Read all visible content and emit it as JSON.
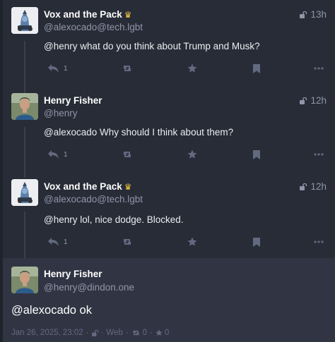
{
  "colors": {
    "background": "#282c37",
    "focused_background": "#313543",
    "muted_text": "#8e96a8",
    "icon": "#626a80",
    "crown": "#f2c744"
  },
  "statuses": [
    {
      "display_name": "Vox and the Pack",
      "badge_icon": "crown-icon",
      "handle": "@alexocado@tech.lgbt",
      "time": "13h",
      "visibility_icon": "unlock-icon",
      "text": "@henry what do you think about Trump and Musk?",
      "reply_count": "1"
    },
    {
      "display_name": "Henry Fisher",
      "handle": "@henry",
      "time": "12h",
      "visibility_icon": "unlock-icon",
      "text": "@alexocado Why should I think about them?",
      "reply_count": "1"
    },
    {
      "display_name": "Vox and the Pack",
      "badge_icon": "crown-icon",
      "handle": "@alexocado@tech.lgbt",
      "time": "12h",
      "visibility_icon": "unlock-icon",
      "text": "@henry lol, nice dodge. Blocked.",
      "reply_count": "1"
    }
  ],
  "detailed_status": {
    "display_name": "Henry Fisher",
    "handle": "@henry@dindon.one",
    "text": "@alexocado ok",
    "date": "Jan 26, 2025, 23:02",
    "separator": "·",
    "application": "Web",
    "boost_count": "0",
    "favourite_count": "0"
  }
}
